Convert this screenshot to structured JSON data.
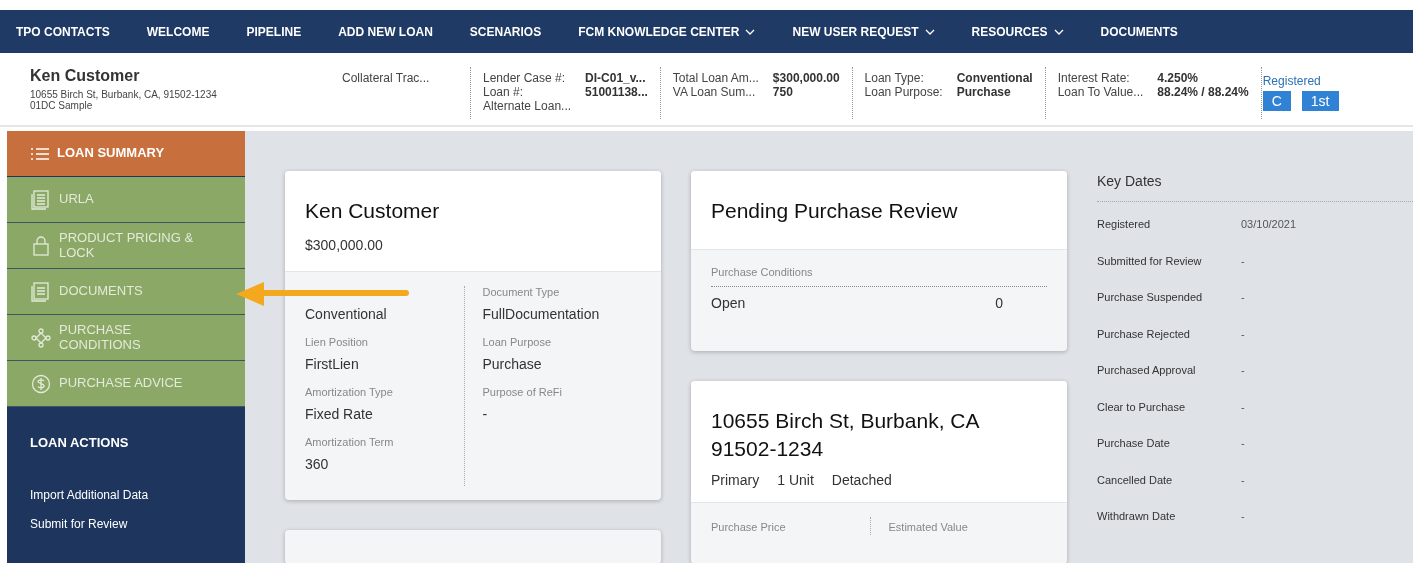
{
  "nav": [
    {
      "label": "TPO CONTACTS",
      "has_menu": false
    },
    {
      "label": "WELCOME",
      "has_menu": false
    },
    {
      "label": "PIPELINE",
      "has_menu": false
    },
    {
      "label": "ADD NEW LOAN",
      "has_menu": false
    },
    {
      "label": "SCENARIOS",
      "has_menu": false
    },
    {
      "label": "FCM KNOWLEDGE CENTER",
      "has_menu": true
    },
    {
      "label": "NEW USER REQUEST",
      "has_menu": true
    },
    {
      "label": "RESOURCES",
      "has_menu": true
    },
    {
      "label": "DOCUMENTS",
      "has_menu": false
    }
  ],
  "header": {
    "name": "Ken Customer",
    "address": "10655 Birch St, Burbank, CA, 91502-1234",
    "sample": "01DC Sample",
    "collateral": "Collateral Trac...",
    "groups": [
      {
        "labels": [
          "Lender Case #:",
          "Loan #:",
          "Alternate Loan..."
        ],
        "values": [
          "DI-C01_v...",
          "51001138..."
        ]
      },
      {
        "labels": [
          "Total Loan Am...",
          "VA Loan Sum..."
        ],
        "values": [
          "$300,000.00",
          "750"
        ]
      },
      {
        "labels": [
          "Loan Type:",
          "Loan Purpose:"
        ],
        "values": [
          "Conventional",
          "Purchase"
        ]
      },
      {
        "labels": [
          "Interest Rate:",
          "Loan To Value..."
        ],
        "values": [
          "4.250%",
          "88.24% / 88.24%"
        ]
      }
    ],
    "status": "Registered",
    "badges": [
      "C",
      "1st"
    ]
  },
  "sidebar": {
    "items": [
      {
        "label": "LOAN SUMMARY",
        "selected": true
      },
      {
        "label": "URLA",
        "selected": false
      },
      {
        "label": "PRODUCT PRICING & LOCK",
        "selected": false
      },
      {
        "label": "DOCUMENTS",
        "selected": false
      },
      {
        "label": "PURCHASE CONDITIONS",
        "selected": false
      },
      {
        "label": "PURCHASE ADVICE",
        "selected": false
      }
    ],
    "actions_title": "LOAN ACTIONS",
    "actions": [
      "Import Additional Data",
      "Submit for Review"
    ]
  },
  "borrower_card": {
    "name": "Ken Customer",
    "amount": "$300,000.00",
    "left": [
      {
        "value": "Conventional"
      },
      {
        "label": "Lien Position",
        "value": "FirstLien"
      },
      {
        "label": "Amortization Type",
        "value": "Fixed Rate"
      },
      {
        "label": "Amortization Term",
        "value": "360"
      }
    ],
    "right": [
      {
        "label": "Document Type",
        "value": "FullDocumentation"
      },
      {
        "label": "Loan Purpose",
        "value": "Purchase"
      },
      {
        "label": "Purpose of ReFi",
        "value": "-"
      }
    ]
  },
  "review_card": {
    "title": "Pending Purchase Review",
    "section": "Purchase Conditions",
    "rows": [
      {
        "label": "Open",
        "count": "0"
      }
    ]
  },
  "property_card": {
    "title": "10655 Birch St, Burbank, CA 91502-1234",
    "tags": [
      "Primary",
      "1 Unit",
      "Detached"
    ],
    "fields": [
      "Purchase Price",
      "Estimated Value"
    ]
  },
  "key_dates": {
    "title": "Key Dates",
    "rows": [
      {
        "label": "Registered",
        "value": "03/10/2021"
      },
      {
        "label": "Submitted for Review",
        "value": "-"
      },
      {
        "label": "Purchase Suspended",
        "value": "-"
      },
      {
        "label": "Purchase Rejected",
        "value": "-"
      },
      {
        "label": "Purchased Approval",
        "value": "-"
      },
      {
        "label": "Clear to Purchase",
        "value": "-"
      },
      {
        "label": "Purchase Date",
        "value": "-"
      },
      {
        "label": "Cancelled Date",
        "value": "-"
      },
      {
        "label": "Withdrawn Date",
        "value": "-"
      }
    ]
  }
}
